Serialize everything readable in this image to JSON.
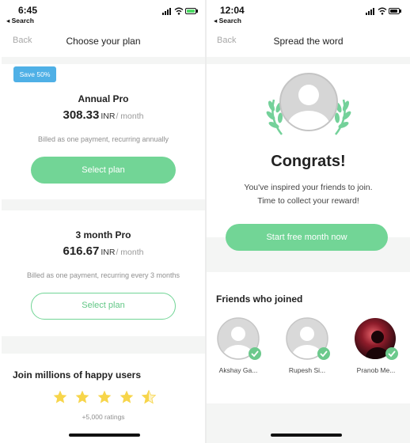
{
  "left_screen": {
    "status": {
      "time": "6:45",
      "back_app": "◂ Search",
      "battery_color": "#4cd964"
    },
    "nav": {
      "back": "Back",
      "title": "Choose your plan"
    },
    "annual": {
      "badge": "Save 50%",
      "name": "Annual Pro",
      "price": "308.33",
      "currency": "INR",
      "period": "/ month",
      "billing": "Billed as one payment, recurring annually",
      "button": "Select plan"
    },
    "quarterly": {
      "name": "3 month Pro",
      "price": "616.67",
      "currency": "INR",
      "period": "/ month",
      "billing": "Billed as one payment, recurring every 3 months",
      "button": "Select plan"
    },
    "social_proof": {
      "heading": "Join millions of happy users",
      "rating_stars": 4.5,
      "ratings_count": "+5,000 ratings"
    }
  },
  "right_screen": {
    "status": {
      "time": "12:04",
      "back_app": "◂ Search",
      "battery_color": "#111111"
    },
    "nav": {
      "back": "Back",
      "title": "Spread the word"
    },
    "headline": "Congrats!",
    "message_line1": "You've inspired your friends to join.",
    "message_line2": "Time to collect your reward!",
    "button": "Start free month now",
    "friends": {
      "heading": "Friends who joined",
      "items": [
        {
          "name": "Akshay Ga..."
        },
        {
          "name": "Rupesh Si..."
        },
        {
          "name": "Pranob Me..."
        }
      ]
    }
  },
  "colors": {
    "accent_green": "#72d596",
    "badge_blue": "#4fb0e6",
    "check_green": "#6cc98c",
    "laurel_green": "#74d19a",
    "section_gray": "#f4f5f4"
  }
}
